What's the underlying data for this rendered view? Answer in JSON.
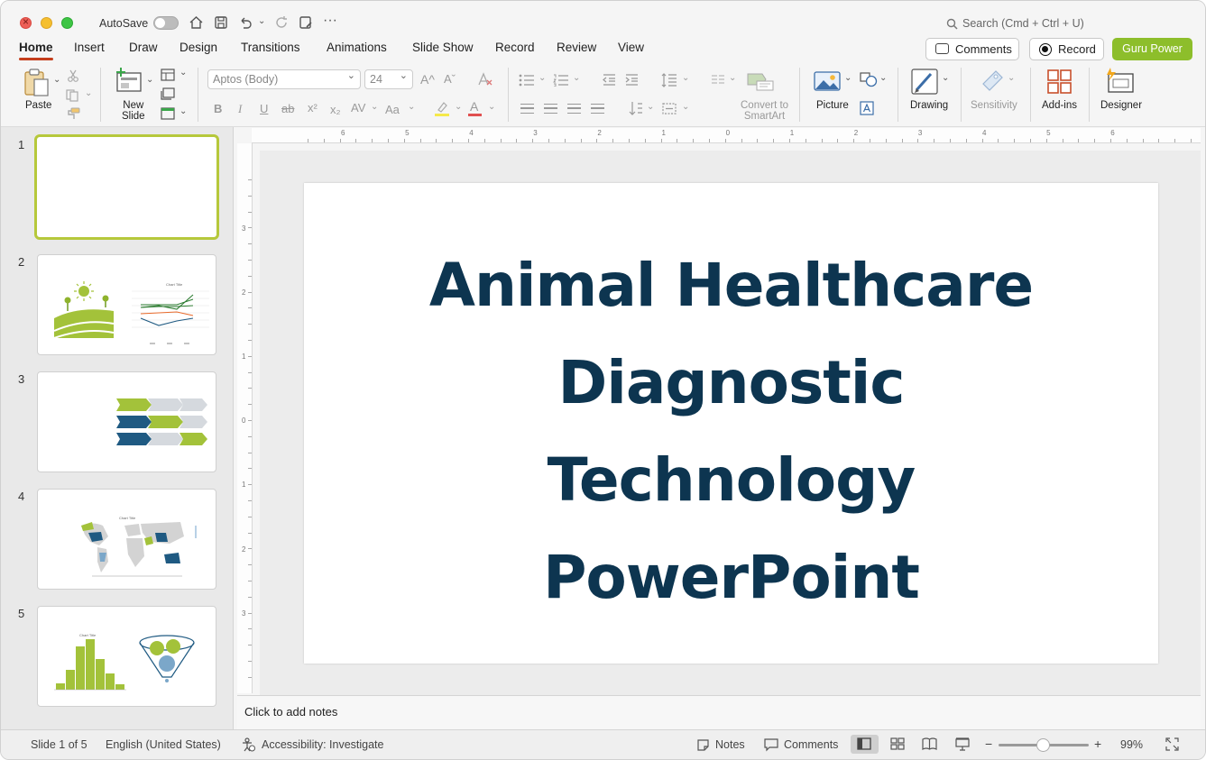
{
  "titlebar": {
    "autosave_label": "AutoSave",
    "search_placeholder": "Search (Cmd + Ctrl + U)",
    "more": "···"
  },
  "tabs": [
    {
      "label": "Home",
      "active": true
    },
    {
      "label": "Insert"
    },
    {
      "label": "Draw"
    },
    {
      "label": "Design"
    },
    {
      "label": "Transitions"
    },
    {
      "label": "Animations"
    },
    {
      "label": "Slide Show"
    },
    {
      "label": "Record"
    },
    {
      "label": "Review"
    },
    {
      "label": "View"
    }
  ],
  "top_buttons": {
    "comments": "Comments",
    "record": "Record",
    "guru": "Guru Power"
  },
  "ribbon": {
    "paste": "Paste",
    "new_slide": "New\nSlide",
    "font_name": "Aptos (Body)",
    "font_size": "24",
    "convert_smartart": "Convert to\nSmartArt",
    "picture": "Picture",
    "drawing": "Drawing",
    "sensitivity": "Sensitivity",
    "addins": "Add-ins",
    "designer": "Designer",
    "fmt_bold": "B",
    "fmt_italic": "I",
    "fmt_underline": "U",
    "fmt_strike": "ab",
    "fmt_super": "x²",
    "fmt_sub": "x₂",
    "fmt_spacing": "AV",
    "fmt_case": "Aa",
    "grow": "A^",
    "shrink": "Aˇ",
    "font_color_glyph": "A"
  },
  "thumbnails": [
    {
      "number": "1",
      "selected": true
    },
    {
      "number": "2",
      "chart_title": "Chart Title"
    },
    {
      "number": "3"
    },
    {
      "number": "4",
      "chart_title": "Chart Title"
    },
    {
      "number": "5",
      "chart_title": "Chart Title"
    }
  ],
  "ruler": {
    "h_ticks": [
      "6",
      "5",
      "4",
      "3",
      "2",
      "1",
      "0",
      "1",
      "2",
      "3",
      "4",
      "5",
      "6"
    ],
    "v_ticks": [
      "3",
      "2",
      "1",
      "0",
      "1",
      "2",
      "3"
    ]
  },
  "slide": {
    "title_lines": [
      "Animal Healthcare",
      "Diagnostic",
      "Technology",
      "PowerPoint"
    ]
  },
  "notes_placeholder": "Click to add notes",
  "status": {
    "slide_info": "Slide 1 of 5",
    "language": "English (United States)",
    "accessibility": "Accessibility: Investigate",
    "notes": "Notes",
    "comments": "Comments",
    "zoom": "99%",
    "zoom_level": 0.99
  },
  "colors": {
    "accent_green": "#8dbe2b",
    "title_navy": "#0d3550",
    "thumb_blue": "#1f5a82",
    "tab_underline": "#c43e1c"
  }
}
